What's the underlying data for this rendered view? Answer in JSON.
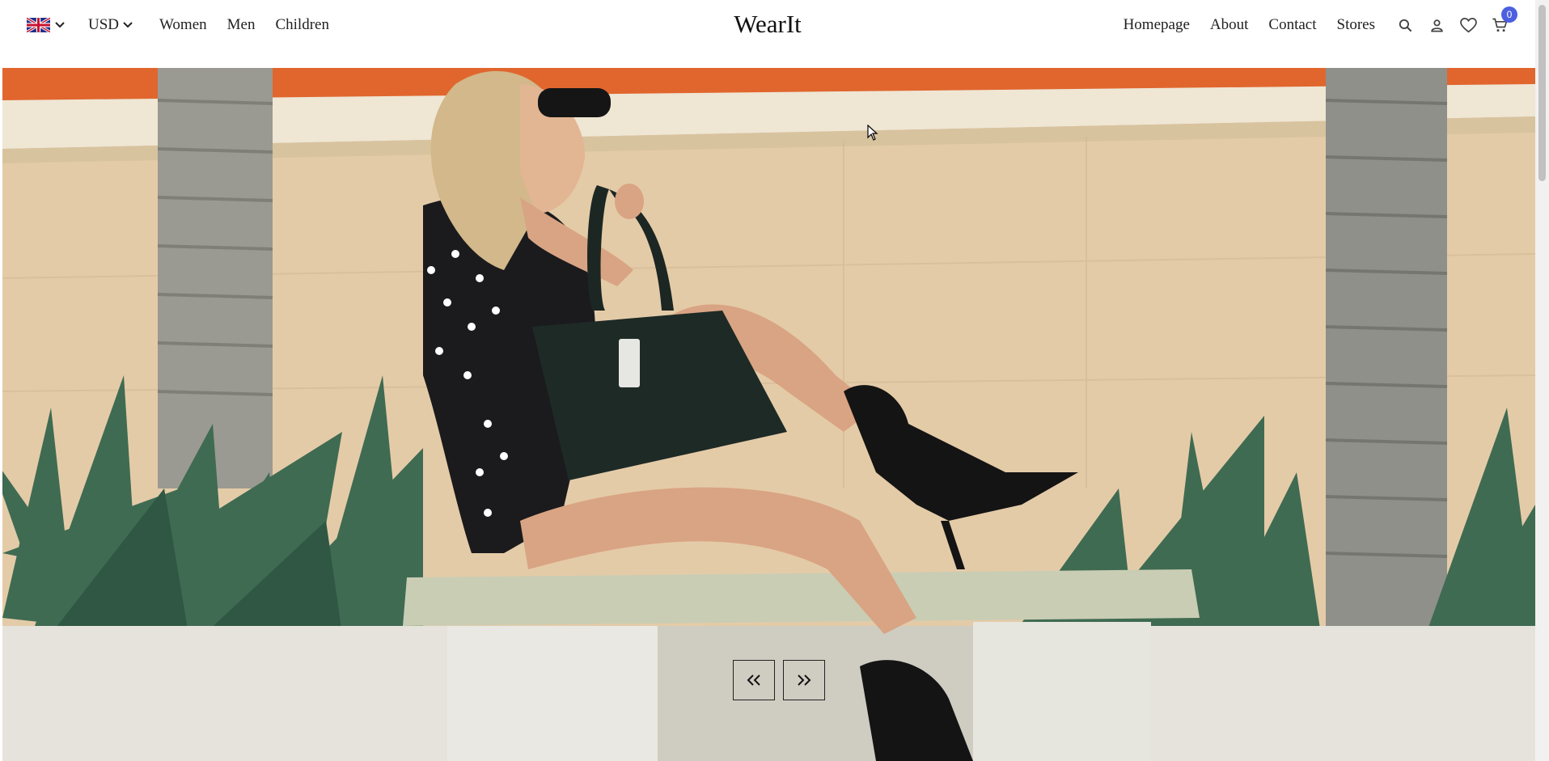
{
  "nav": {
    "currency": "USD",
    "left_links": [
      "Women",
      "Men",
      "Children"
    ],
    "brand": "WearIt",
    "right_links": [
      "Homepage",
      "About",
      "Contact",
      "Stores"
    ],
    "cart_count": "0"
  },
  "icons": {
    "language": "uk-flag-icon",
    "search": "search-icon",
    "account": "user-icon",
    "wishlist": "heart-icon",
    "cart": "cart-icon",
    "prev": "double-chevron-left-icon",
    "next": "double-chevron-right-icon"
  },
  "colors": {
    "badge": "#4c5fe0",
    "text": "#222222",
    "hero_wall": "#e4cba8"
  }
}
